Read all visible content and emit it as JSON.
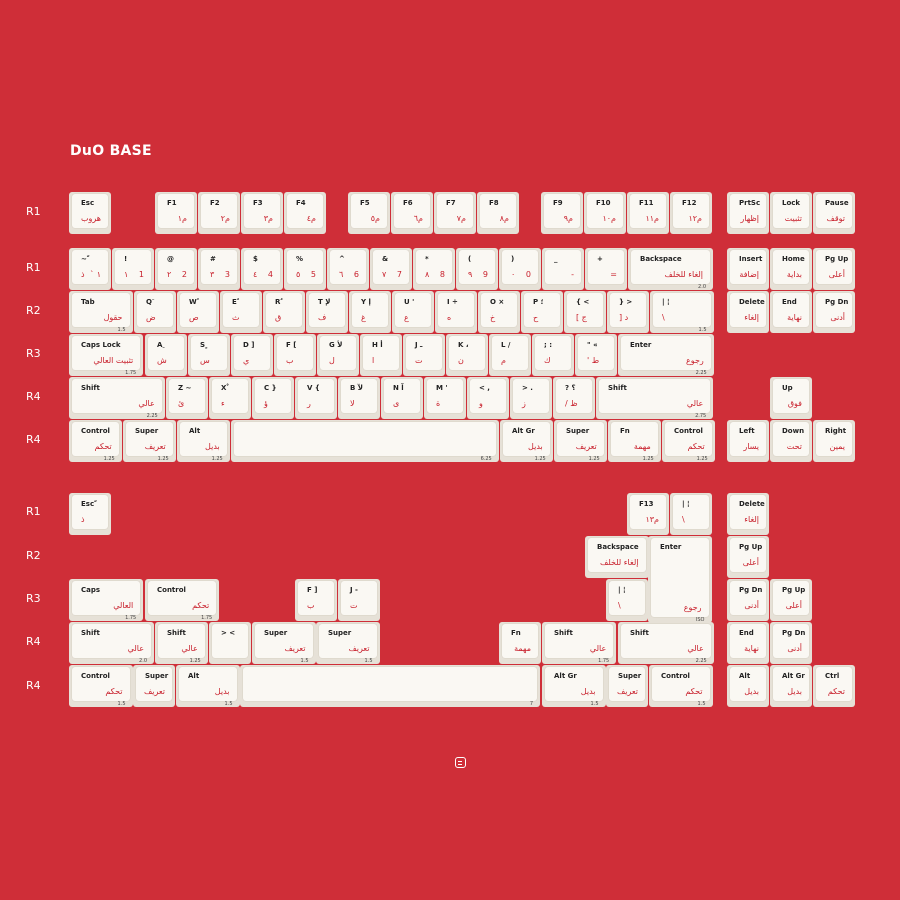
{
  "title": "DuO BASE",
  "colors": {
    "background": "#cf2e38",
    "keycap": "#faf8f3",
    "legend_dark": "#222222",
    "legend_red": "#c8202c"
  },
  "row_labels": [
    {
      "text": "R1",
      "y": 0
    },
    {
      "text": "R1",
      "y": 0
    },
    {
      "text": "R2",
      "y": 0
    },
    {
      "text": "R3",
      "y": 0
    },
    {
      "text": "R4",
      "y": 0
    },
    {
      "text": "R4",
      "y": 0
    },
    {
      "text": "R1",
      "y": 0
    },
    {
      "text": "R2",
      "y": 0
    },
    {
      "text": "R3",
      "y": 0
    },
    {
      "text": "R4",
      "y": 0
    },
    {
      "text": "R4",
      "y": 0
    }
  ],
  "keys": [
    [
      "Esc",
      "هروب",
      "",
      "",
      ""
    ],
    [
      "F1",
      "",
      "م١",
      "",
      ""
    ],
    [
      "F2",
      "",
      "م٢",
      "",
      ""
    ],
    [
      "F3",
      "",
      "م٣",
      "",
      ""
    ],
    [
      "F4",
      "",
      "م٤",
      "",
      ""
    ],
    [
      "F5",
      "",
      "م٥",
      "",
      ""
    ],
    [
      "F6",
      "",
      "م٦",
      "",
      ""
    ],
    [
      "F7",
      "",
      "م٧",
      "",
      ""
    ],
    [
      "F8",
      "",
      "م٨",
      "",
      ""
    ],
    [
      "F9",
      "",
      "م٩",
      "",
      ""
    ],
    [
      "F10",
      "",
      "م١٠",
      "",
      ""
    ],
    [
      "F11",
      "",
      "م١١",
      "",
      ""
    ],
    [
      "F12",
      "",
      "م١٢",
      "",
      ""
    ],
    [
      "PrtSc",
      "",
      "إظهار",
      "",
      ""
    ],
    [
      "Lock",
      "",
      "تثبيت",
      "",
      ""
    ],
    [
      "Pause",
      "",
      "توقف",
      "",
      ""
    ],
    [
      "~ ّ",
      "ذ",
      "` ١",
      "",
      ""
    ],
    [
      "!",
      "١",
      "1",
      "",
      ""
    ],
    [
      "@",
      "٢",
      "2",
      "",
      ""
    ],
    [
      "#",
      "٣",
      "3",
      "",
      ""
    ],
    [
      "$",
      "٤",
      "4",
      "",
      ""
    ],
    [
      "%",
      "٥",
      "5",
      "",
      ""
    ],
    [
      "^",
      "٦",
      "6",
      "",
      ""
    ],
    [
      "&",
      "٧",
      "7",
      "",
      ""
    ],
    [
      "*",
      "٨",
      "8",
      "",
      ""
    ],
    [
      "(",
      "٩",
      "9",
      "",
      ""
    ],
    [
      ")",
      "٠",
      "0",
      "",
      ""
    ],
    [
      "_",
      "",
      "-",
      "",
      ""
    ],
    [
      "+",
      "",
      "=",
      "",
      ""
    ],
    [
      "Backspace",
      "",
      "إلغاء للخلف",
      "2.0",
      ""
    ],
    [
      "Insert",
      "",
      "إضافة",
      "",
      ""
    ],
    [
      "Home",
      "",
      "بداية",
      "",
      ""
    ],
    [
      "Pg Up",
      "",
      "أعلى",
      "",
      ""
    ],
    [
      "Tab",
      "",
      "حقول",
      "1.5",
      ""
    ],
    [
      "Q َ",
      "ض",
      "",
      "",
      ""
    ],
    [
      "W ً",
      "ص",
      "",
      "",
      ""
    ],
    [
      "E ُ",
      "ث",
      "",
      "",
      ""
    ],
    [
      "R ٌ",
      "ق",
      "",
      "",
      ""
    ],
    [
      "T لإ",
      "ف",
      "",
      "",
      ""
    ],
    [
      "Y إ",
      "غ",
      "",
      "",
      ""
    ],
    [
      "U '",
      "ع",
      "",
      "",
      ""
    ],
    [
      "I ÷",
      "ه",
      "",
      "",
      ""
    ],
    [
      "O ×",
      "خ",
      "",
      "",
      ""
    ],
    [
      "P ؛",
      "ح",
      "",
      "",
      ""
    ],
    [
      "{ <",
      "[ ج",
      "",
      "",
      ""
    ],
    [
      "} >",
      "] د",
      "",
      "",
      ""
    ],
    [
      "| ¦",
      "\\",
      "",
      "1.5",
      ""
    ],
    [
      "Delete",
      "",
      "إلغاء",
      "",
      ""
    ],
    [
      "End",
      "",
      "نهاية",
      "",
      ""
    ],
    [
      "Pg Dn",
      "",
      "أدنى",
      "",
      ""
    ],
    [
      "Caps Lock",
      "",
      "تثبيت العالي",
      "1.75",
      ""
    ],
    [
      "A ِ",
      "ش",
      "",
      "",
      ""
    ],
    [
      "S ٍ",
      "س",
      "",
      "",
      ""
    ],
    [
      "D ]",
      "ي",
      "",
      "",
      ""
    ],
    [
      "F [",
      "ب",
      "",
      "",
      ""
    ],
    [
      "G لأ",
      "ل",
      "",
      "",
      ""
    ],
    [
      "H أ",
      "ا",
      "",
      "",
      ""
    ],
    [
      "J ـ",
      "ت",
      "",
      "",
      ""
    ],
    [
      "K ،",
      "ن",
      "",
      "",
      ""
    ],
    [
      "L /",
      "م",
      "",
      "",
      ""
    ],
    [
      "; :",
      "ك",
      "",
      "",
      ""
    ],
    [
      "\" «",
      "' ط",
      "",
      "",
      ""
    ],
    [
      "Enter",
      "",
      "رجوع",
      "2.25",
      ""
    ],
    [
      "Shift",
      "",
      "عالي",
      "2.25",
      ""
    ],
    [
      "Z ~",
      "ئ",
      "",
      "",
      ""
    ],
    [
      "X ْ",
      "ء",
      "",
      "",
      ""
    ],
    [
      "C }",
      "ؤ",
      "",
      "",
      ""
    ],
    [
      "V {",
      "ر",
      "",
      "",
      ""
    ],
    [
      "B لآ",
      "لا",
      "",
      "",
      ""
    ],
    [
      "N آ",
      "ى",
      "",
      "",
      ""
    ],
    [
      "M '",
      "ة",
      "",
      "",
      ""
    ],
    [
      "< ,",
      "و",
      "",
      "",
      ""
    ],
    [
      "> .",
      "ز",
      "",
      "",
      ""
    ],
    [
      "? ؟",
      "/ ظ",
      "",
      "",
      ""
    ],
    [
      "Shift",
      "",
      "عالي",
      "2.75",
      ""
    ],
    [
      "Up",
      "",
      "فوق",
      "",
      ""
    ],
    [
      "Control",
      "",
      "تحكم",
      "1.25",
      ""
    ],
    [
      "Super",
      "",
      "تعريف",
      "1.25",
      ""
    ],
    [
      "Alt",
      "",
      "بديل",
      "1.25",
      ""
    ],
    [
      "",
      "",
      "",
      "6.25",
      ""
    ],
    [
      "Alt Gr",
      "",
      "بديل",
      "1.25",
      ""
    ],
    [
      "Super",
      "",
      "تعريف",
      "1.25",
      ""
    ],
    [
      "Fn",
      "",
      "مهمة",
      "1.25",
      ""
    ],
    [
      "Control",
      "",
      "تحكم",
      "1.25",
      ""
    ],
    [
      "Left",
      "",
      "يسار",
      "",
      ""
    ],
    [
      "Down",
      "",
      "تحت",
      "",
      ""
    ],
    [
      "Right",
      "",
      "يمين",
      "",
      ""
    ],
    [
      "Esc ّ",
      "ذ",
      "",
      "",
      ""
    ],
    [
      "F13",
      "",
      "م١٣",
      "",
      ""
    ],
    [
      "| ¦",
      "\\",
      "",
      "",
      ""
    ],
    [
      "Delete",
      "",
      "إلغاء",
      "",
      ""
    ],
    [
      "Backspace",
      "",
      "إلغاء للخلف",
      "",
      ""
    ],
    [
      "Enter",
      "",
      "رجوع",
      "ISO",
      ""
    ],
    [
      "Pg Up",
      "",
      "أعلى",
      "",
      ""
    ],
    [
      "Caps",
      "",
      "العالي",
      "1.75",
      ""
    ],
    [
      "Control",
      "",
      "تحكم",
      "1.75",
      ""
    ],
    [
      "F ]",
      "ب",
      "",
      "",
      ""
    ],
    [
      "J -",
      "ت",
      "",
      "",
      ""
    ],
    [
      "| ¦",
      "\\",
      "",
      "",
      ""
    ],
    [
      "Pg Dn",
      "",
      "أدنى",
      "",
      ""
    ],
    [
      "Pg Up",
      "",
      "أعلى",
      "",
      ""
    ],
    [
      "Shift",
      "",
      "عالي",
      "2.0",
      ""
    ],
    [
      "Shift",
      "",
      "عالي",
      "1.25",
      ""
    ],
    [
      "> <",
      "",
      "",
      "",
      ""
    ],
    [
      "Super",
      "",
      "تعريف",
      "1.5",
      ""
    ],
    [
      "Super",
      "",
      "تعريف",
      "1.5",
      ""
    ],
    [
      "Fn",
      "",
      "مهمة",
      "",
      ""
    ],
    [
      "Shift",
      "",
      "عالي",
      "1.75",
      ""
    ],
    [
      "Shift",
      "",
      "عالي",
      "2.25",
      ""
    ],
    [
      "End",
      "",
      "نهاية",
      "",
      ""
    ],
    [
      "Pg Dn",
      "",
      "أدنى",
      "",
      ""
    ],
    [
      "Control",
      "",
      "تحكم",
      "1.5",
      ""
    ],
    [
      "Super",
      "",
      "تعريف",
      "",
      ""
    ],
    [
      "Alt",
      "",
      "بديل",
      "1.5",
      ""
    ],
    [
      "",
      "",
      "",
      "7",
      ""
    ],
    [
      "Alt Gr",
      "",
      "بديل",
      "1.5",
      ""
    ],
    [
      "Super",
      "",
      "تعريف",
      "",
      ""
    ],
    [
      "Control",
      "",
      "تحكم",
      "1.5",
      ""
    ],
    [
      "Alt",
      "",
      "بديل",
      "",
      ""
    ],
    [
      "Alt Gr",
      "",
      "بديل",
      "",
      ""
    ],
    [
      "Ctrl",
      "",
      "تحكم",
      "",
      ""
    ]
  ]
}
